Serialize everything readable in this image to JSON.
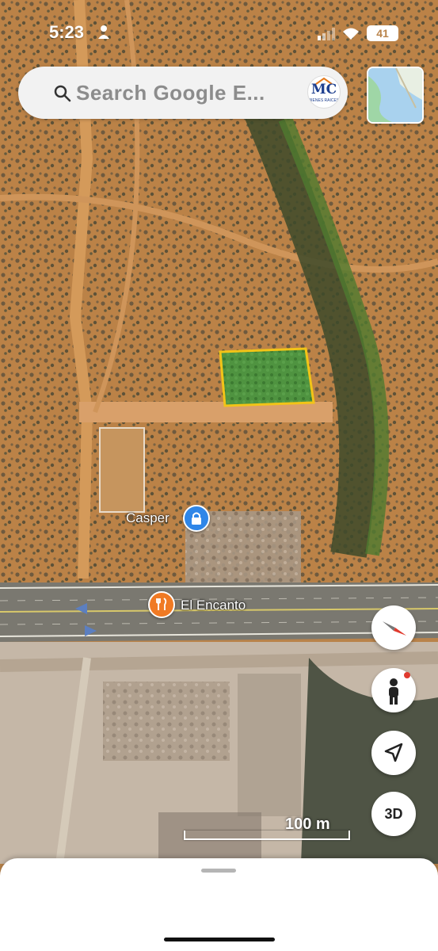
{
  "status_bar": {
    "time": "5:23",
    "battery": "41"
  },
  "search": {
    "placeholder": "Search Google E...",
    "avatar_text": "MC",
    "avatar_subtext": "BIENES RAICES"
  },
  "map": {
    "pois": [
      {
        "name": "Casper",
        "icon": "lock-icon",
        "color": "#2f86e8"
      },
      {
        "name": "El Encanto",
        "icon": "restaurant-icon",
        "color": "#f07a24"
      }
    ],
    "scale_label": "100 m",
    "highlight_color": "#3a9a3a"
  },
  "controls": {
    "compass": "compass-icon",
    "pegman": "pegman-icon",
    "location": "navigation-arrow-icon",
    "view_3d_label": "3D"
  }
}
